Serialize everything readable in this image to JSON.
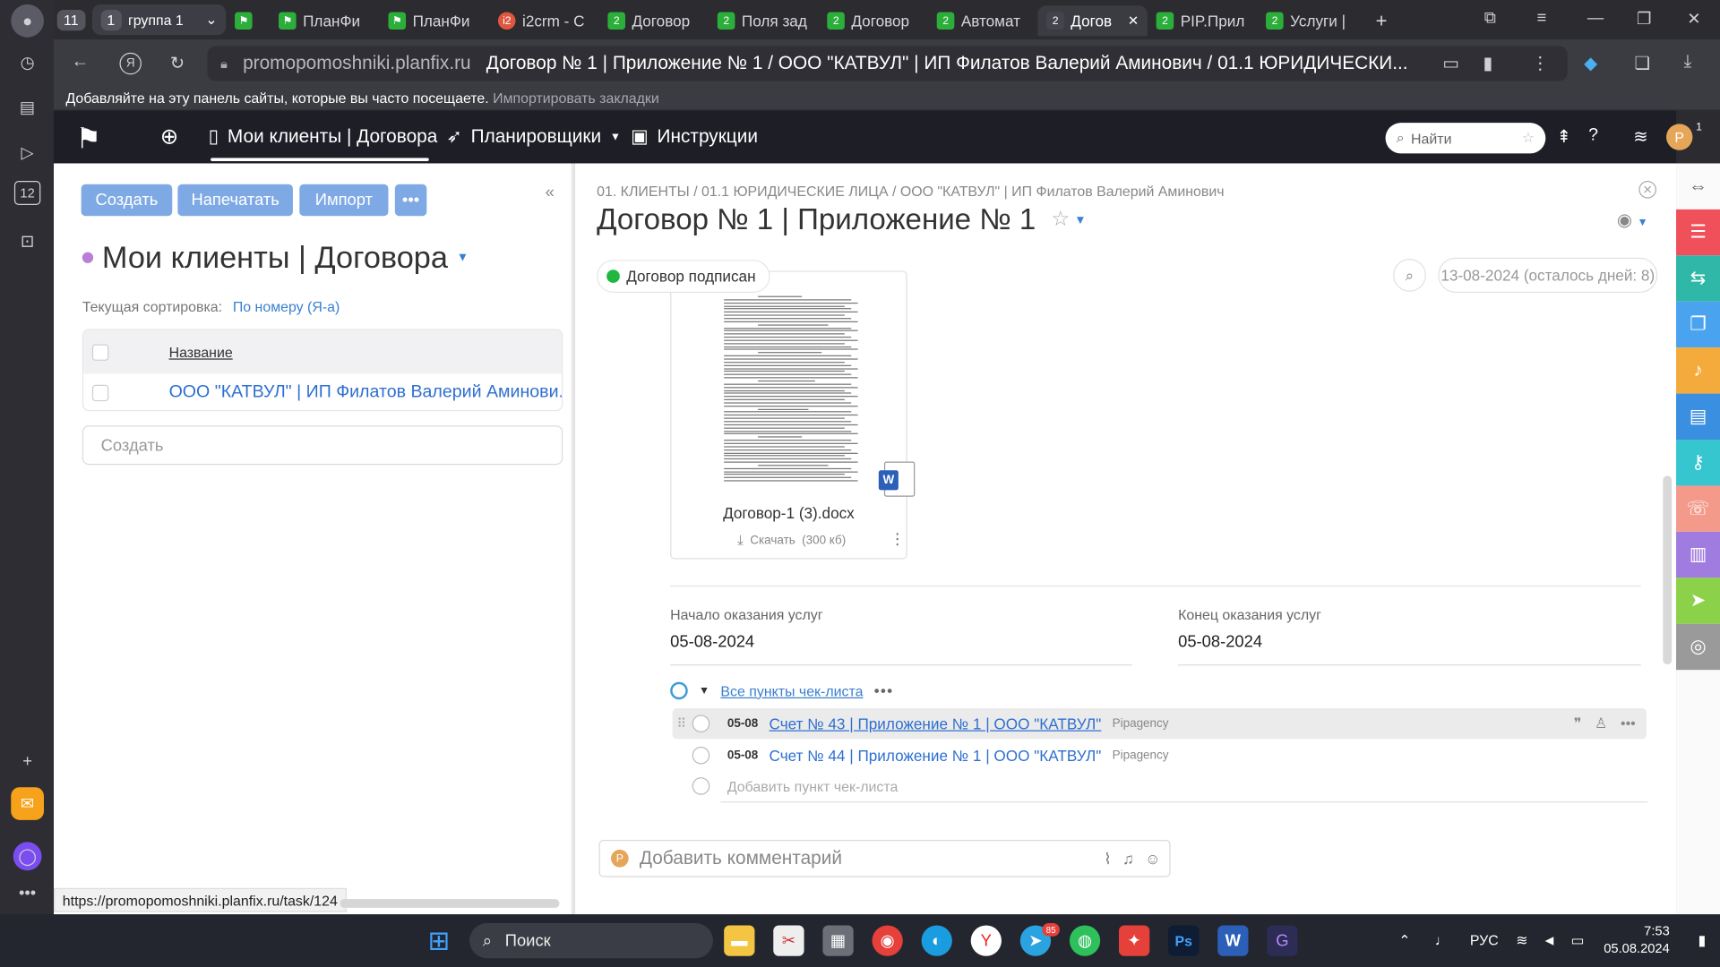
{
  "browser": {
    "tab_counter": "11",
    "group_count": "1",
    "group_label": "группа 1",
    "tabs": [
      {
        "label": "ПланФи",
        "fav": "",
        "style": "green"
      },
      {
        "label": "ПланФи",
        "fav": "",
        "style": "green"
      },
      {
        "label": "i2crm - C",
        "fav": "i2",
        "style": "red"
      },
      {
        "label": "Договор",
        "fav": "2",
        "style": "green"
      },
      {
        "label": "Поля зад",
        "fav": "2",
        "style": "green"
      },
      {
        "label": "Договор",
        "fav": "2",
        "style": "green"
      },
      {
        "label": "Автомат",
        "fav": "2",
        "style": "green"
      },
      {
        "label": "Догов",
        "fav": "2",
        "style": "dark",
        "active": true
      },
      {
        "label": "PIP.Прил",
        "fav": "2",
        "style": "green"
      },
      {
        "label": "Услуги |",
        "fav": "2",
        "style": "green"
      }
    ],
    "address_host": "promopomoshniki.planfix.ru",
    "address_title": "Договор № 1 | Приложение № 1 / ООО \"КАТВУЛ\" | ИП Филатов Валерий Аминович / 01.1 ЮРИДИЧЕСКИ...",
    "bookmarks_hint": "Добавляйте на эту панель сайты, которые вы часто посещаете.",
    "bookmarks_import": "Импортировать закладки",
    "rail_badge": "12",
    "status_url": "https://promopomoshniki.planfix.ru/task/124"
  },
  "app": {
    "nav": {
      "clients": "Мои клиенты | Договора",
      "schedulers": "Планировщики",
      "instructions": "Инструкции"
    },
    "search_placeholder": "Найти",
    "avatar_letter": "P",
    "avatar_badge": "1"
  },
  "left": {
    "buttons": {
      "create": "Создать",
      "print": "Напечатать",
      "import": "Импорт",
      "more": "•••"
    },
    "title": "Мои клиенты | Договора",
    "sort_label": "Текущая сортировка:",
    "sort_value": "По номеру (Я-а)",
    "column_name": "Название",
    "rows": [
      "ООО \"КАТВУЛ\" | ИП Филатов Валерий Аминови..."
    ],
    "create_placeholder": "Создать"
  },
  "task": {
    "breadcrumb": "01. КЛИЕНТЫ / 01.1 ЮРИДИЧЕСКИЕ ЛИЦА / ООО \"КАТВУЛ\" | ИП Филатов Валерий Аминович",
    "title": "Договор № 1 | Приложение № 1",
    "status": "Договор подписан",
    "deadline": "13-08-2024  (осталось дней: 8)",
    "file": {
      "name": "Договор-1 (3).docx",
      "download": "Скачать",
      "size": "(300 кб)",
      "type_letter": "W"
    },
    "fields": {
      "start_label": "Начало оказания услуг",
      "start_value": "05-08-2024",
      "end_label": "Конец оказания услуг",
      "end_value": "05-08-2024"
    },
    "checklist": {
      "header": "Все пункты чек-листа",
      "items": [
        {
          "date": "05-08",
          "title": "Счет № 43 | Приложение № 1 | ООО \"КАТВУЛ\"",
          "tag": "Pipagency"
        },
        {
          "date": "05-08",
          "title": "Счет № 44 | Приложение № 1 | ООО \"КАТВУЛ\"",
          "tag": "Pipagency"
        }
      ],
      "add_placeholder": "Добавить пункт чек-листа"
    },
    "comment_placeholder": "Добавить комментарий",
    "comment_avatar": "P"
  },
  "right_rail_colors": [
    "#ffffff",
    "#f0505a",
    "#2fb8a7",
    "#4aa3ef",
    "#f4ab3c",
    "#3a8fe0",
    "#35c6cf",
    "#f39a8a",
    "#a07ce0",
    "#8bd24a",
    "#9a9a9a"
  ],
  "taskbar": {
    "search": "Поиск",
    "lang": "РУС",
    "time": "7:53",
    "date": "05.08.2024",
    "telegram_badge": "85"
  }
}
